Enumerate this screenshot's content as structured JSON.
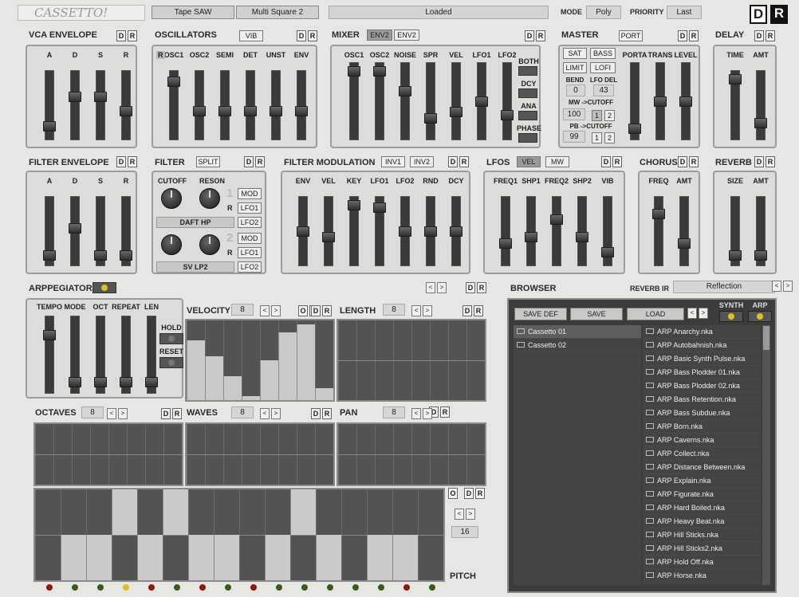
{
  "header": {
    "logo": "CASSETTO!",
    "preset1": "Tape SAW",
    "preset2": "Multi Square 2",
    "status": "Loaded",
    "mode_label": "MODE",
    "mode_value": "Poly",
    "priority_label": "PRIORITY",
    "priority_value": "Last",
    "d": "D",
    "r": "R"
  },
  "sections": {
    "vca": "VCA ENVELOPE",
    "osc": "OSCILLATORS",
    "vib": "VIB",
    "mixer": "MIXER",
    "env2": "ENV2",
    "env2b": "ENV2",
    "master": "MASTER",
    "port": "PORT",
    "delay": "DELAY",
    "filterenv": "FILTER ENVELOPE",
    "filter": "FILTER",
    "split": "SPLIT",
    "filtermod": "FILTER MODULATION",
    "inv1": "INV1",
    "inv2": "INV2",
    "lfos": "LFOS",
    "vel": "VEL",
    "mw": "MW",
    "chorus": "CHORUS",
    "reverb": "REVERB",
    "arp": "ARPPEGIATOR",
    "browser": "BROWSER",
    "reverb_ir": "REVERB IR",
    "reverb_ir_value": "Reflection"
  },
  "vca_labels": [
    "A",
    "D",
    "S",
    "R"
  ],
  "osc_labels": [
    "OSC1",
    "OSC2",
    "SEMI",
    "DET",
    "UNST",
    "ENV"
  ],
  "osc_r": "R",
  "mixer_labels": [
    "OSC1",
    "OSC2",
    "NOISE",
    "SPR",
    "VEL",
    "LFO1",
    "LFO2"
  ],
  "mixer_buttons": [
    "BOTH",
    "DCY",
    "ANA",
    "PHASE"
  ],
  "master": {
    "sat": "SAT",
    "bass": "BASS",
    "limit": "LIMIT",
    "lofi": "LOFI",
    "bend": "BEND",
    "bend_val": "0",
    "lfodel": "LFO DEL",
    "lfodel_val": "43",
    "mw": "MW ->CUTOFF",
    "mw_val": "100",
    "pb": "PB ->CUTOFF",
    "pb_val": "99",
    "one": "1",
    "two": "2",
    "porta": "PORTA",
    "trans": "TRANS",
    "level": "LEVEL"
  },
  "delay_labels": [
    "TIME",
    "AMT"
  ],
  "filterenv_labels": [
    "A",
    "D",
    "S",
    "R"
  ],
  "filter": {
    "cutoff": "CUTOFF",
    "reson": "RESON",
    "one": "1",
    "two": "2",
    "mod": "MOD",
    "lfo1": "LFO1",
    "lfo2": "LFO2",
    "r": "R",
    "type1": "DAFT HP",
    "type2": "SV LP2"
  },
  "filtermod_labels": [
    "ENV",
    "VEL",
    "KEY",
    "LFO1",
    "LFO2",
    "RND",
    "DCY"
  ],
  "lfo_labels": [
    "FREQ1",
    "SHP1",
    "FREQ2",
    "SHP2",
    "VIB"
  ],
  "chorus_labels": [
    "FREQ",
    "AMT"
  ],
  "reverb_labels": [
    "SIZE",
    "AMT"
  ],
  "arp": {
    "labels": [
      "TEMPO",
      "MODE",
      "OCT",
      "REPEAT",
      "LEN"
    ],
    "hold": "HOLD",
    "reset": "RESET",
    "velocity": "VELOCITY",
    "vel_steps": "8",
    "length": "LENGTH",
    "len_steps": "8",
    "octaves": "OCTAVES",
    "oct_steps": "8",
    "waves": "WAVES",
    "wave_steps": "8",
    "pan": "PAN",
    "pan_steps": "8",
    "pitch": "PITCH",
    "pitch_steps": "16",
    "o": "O"
  },
  "velocity_values": [
    0.75,
    0.55,
    0.3,
    0.05,
    0.5,
    0.85,
    0.95,
    0.15
  ],
  "browser": {
    "save_def": "SAVE DEF",
    "save": "SAVE",
    "load": "LOAD",
    "synth": "SYNTH",
    "arp": "ARP",
    "folders": [
      "Cassetto 01",
      "Cassetto 02"
    ],
    "files": [
      "ARP Anarchy.nka",
      "ARP Autobahnish.nka",
      "ARP Basic Synth Pulse.nka",
      "ARP Bass Plodder 01.nka",
      "ARP Bass Plodder 02.nka",
      "ARP Bass Retention.nka",
      "ARP Bass Subdue.nka",
      "ARP Born.nka",
      "ARP Caverns.nka",
      "ARP Collect.nka",
      "ARP Distance Between.nka",
      "ARP Explain.nka",
      "ARP Figurate.nka",
      "ARP Hard Boiled.nka",
      "ARP Heavy Beat.nka",
      "ARP Hill Sticks.nka",
      "ARP Hill Sticks2.nka",
      "ARP Hold Off.nka",
      "ARP Horse.nka"
    ]
  },
  "arrows": {
    "left": "<",
    "right": ">"
  },
  "colors": {
    "led_red": "#8a1a10",
    "led_green": "#3a5a20",
    "led_yellow": "#e0c020"
  }
}
